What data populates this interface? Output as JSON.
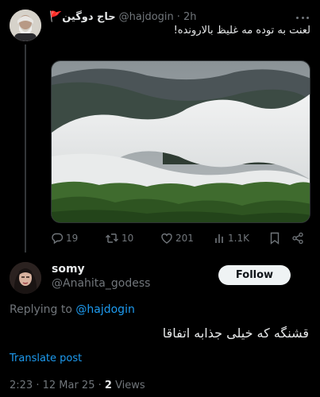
{
  "tweet1": {
    "display_name": "حاج دوگین",
    "flag_emoji": "🚩",
    "handle": "@hajdogin",
    "separator": "·",
    "time": "2h",
    "text": "لعنت به توده مه غلیظ بالارونده!",
    "actions": {
      "replies": "19",
      "retweets": "10",
      "likes": "201",
      "views": "1.1K"
    },
    "icons": [
      "reply-icon",
      "retweet-icon",
      "like-icon",
      "views-icon",
      "bookmark-icon",
      "share-icon",
      "more-icon"
    ]
  },
  "tweet2": {
    "display_name": "somy",
    "handle": "@Anahita_godess",
    "follow_label": "Follow",
    "replying_prefix": "Replying to",
    "replying_mention": "@hajdogin",
    "text": "قشنگه که خیلی جذابه اتفاقا",
    "translate_label": "Translate post",
    "timestamp": "2:23 · 12 Mar 25 ·",
    "views_count": "2",
    "views_label": "Views"
  },
  "colors": {
    "background": "#000000",
    "text_primary": "#e7e9ea",
    "text_secondary": "#71767b",
    "link": "#1d9bf0",
    "divider": "#333639",
    "follow_bg": "#eff3f4"
  }
}
